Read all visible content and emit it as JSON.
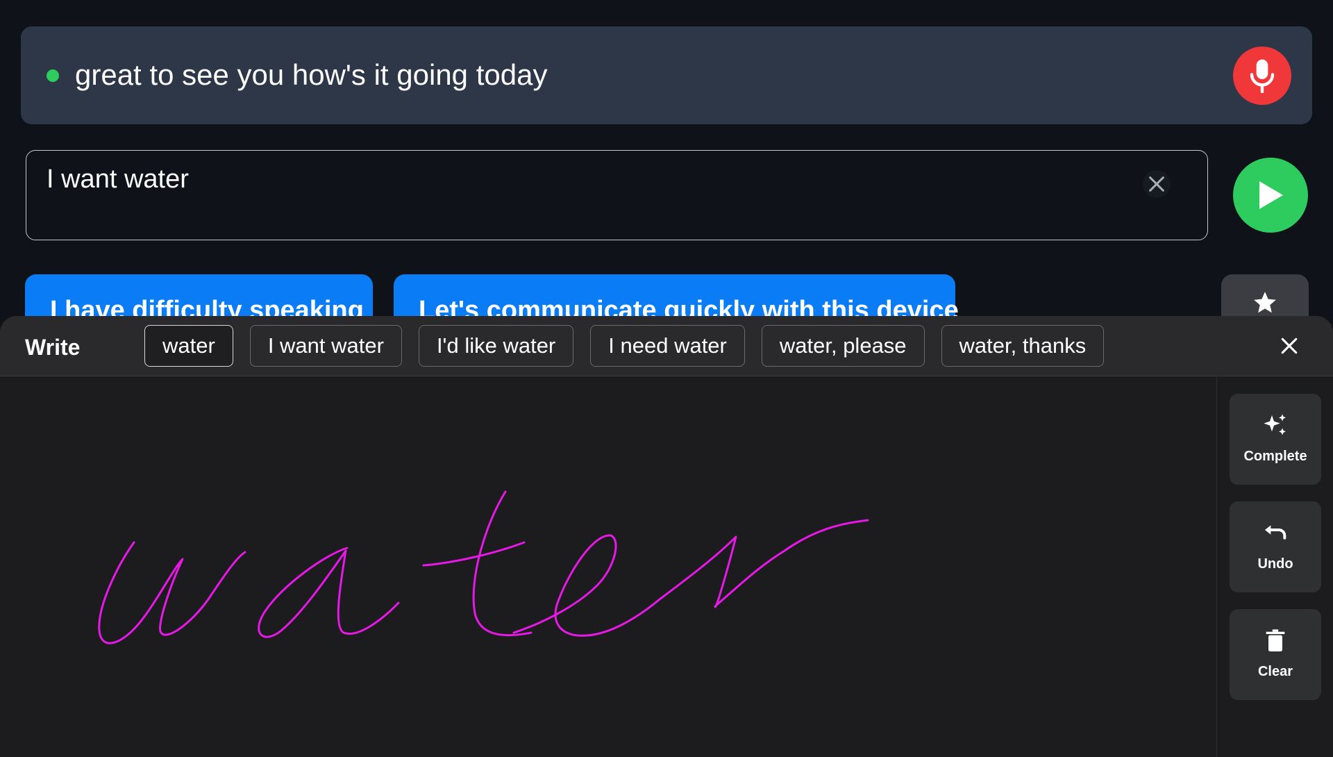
{
  "transcript": {
    "text": "great to see you how's it going today",
    "status_color": "#2ecc5e",
    "mic_icon": "microphone-icon",
    "mic_color": "#f0383a"
  },
  "composer": {
    "value": "I want water",
    "clear_icon": "close-icon",
    "speak_icon": "play-icon",
    "speak_color": "#2ecc5e"
  },
  "phrases": [
    {
      "label": "I have difficulty speaking"
    },
    {
      "label": "Let's communicate quickly with this device"
    }
  ],
  "favorites": {
    "icon": "star-icon"
  },
  "write_panel": {
    "title": "Write",
    "suggestions": [
      {
        "label": "water",
        "selected": true
      },
      {
        "label": "I want water",
        "selected": false
      },
      {
        "label": "I'd like water",
        "selected": false
      },
      {
        "label": "I need water",
        "selected": false
      },
      {
        "label": "water, please",
        "selected": false
      },
      {
        "label": "water, thanks",
        "selected": false
      }
    ],
    "close_icon": "close-icon",
    "ink_color": "#e619e6",
    "tools": {
      "complete": {
        "label": "Complete",
        "icon": "sparkles-icon"
      },
      "undo": {
        "label": "Undo",
        "icon": "undo-icon"
      },
      "clear": {
        "label": "Clear",
        "icon": "trash-icon"
      }
    }
  },
  "colors": {
    "background": "#0f1218",
    "transcript_bg": "#2d3748",
    "phrase_bg": "#0a7cf6",
    "panel_bg": "#1c1c1e"
  }
}
